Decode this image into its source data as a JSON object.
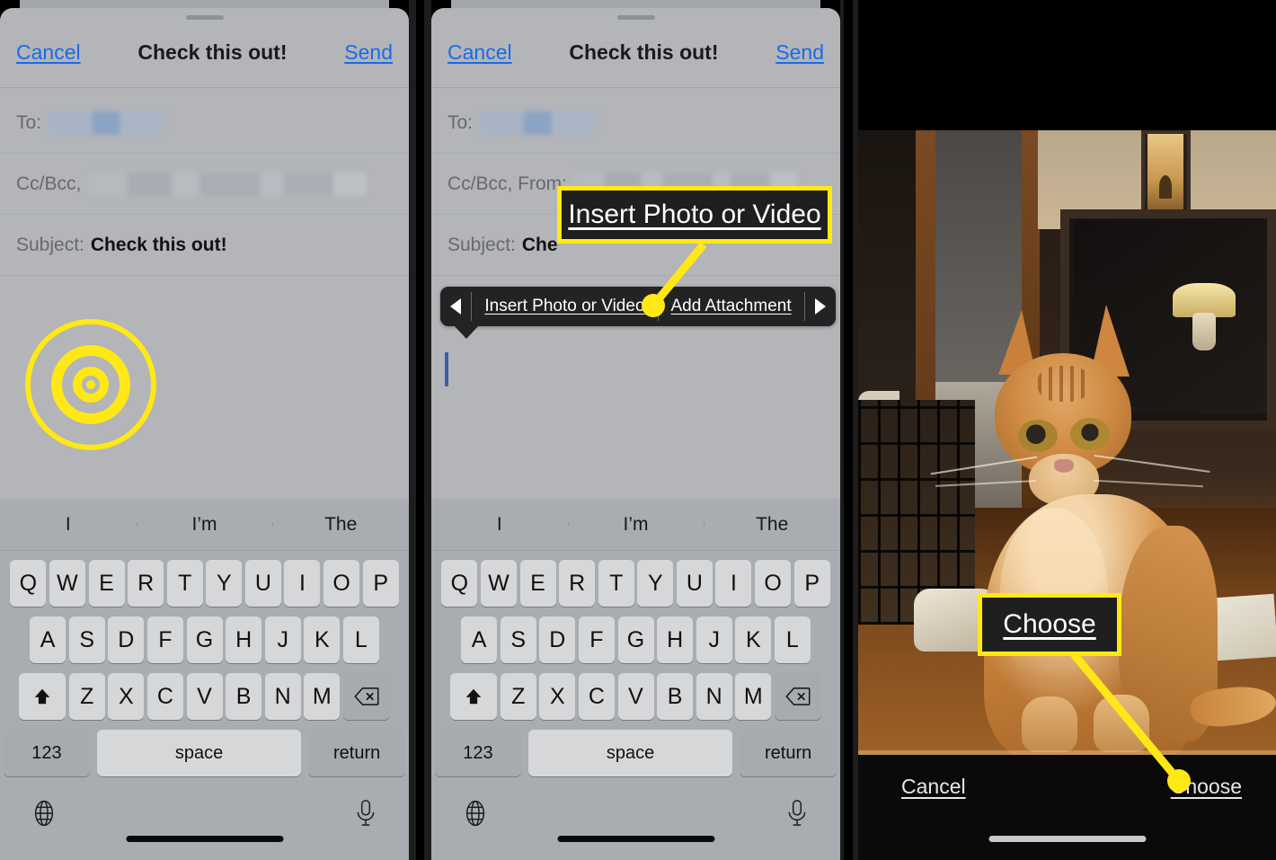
{
  "annotation": {
    "accent_color": "#ffe815",
    "callout_bg": "#1f1f1f",
    "callout_1_text": "Insert Photo or Video",
    "callout_2_text": "Choose"
  },
  "panel1": {
    "nav": {
      "cancel": "Cancel",
      "title": "Check this out!",
      "send": "Send"
    },
    "fields": {
      "to_label": "To:",
      "cc_label": "Cc/Bcc,",
      "subject_label": "Subject:",
      "subject_value": "Check this out!"
    },
    "keyboard": {
      "predictions": [
        "I",
        "I’m",
        "The"
      ],
      "row1": [
        "Q",
        "W",
        "E",
        "R",
        "T",
        "Y",
        "U",
        "I",
        "O",
        "P"
      ],
      "row2": [
        "A",
        "S",
        "D",
        "F",
        "G",
        "H",
        "J",
        "K",
        "L"
      ],
      "row3": [
        "Z",
        "X",
        "C",
        "V",
        "B",
        "N",
        "M"
      ],
      "shift": "shift-icon",
      "backspace": "backspace-icon",
      "numbers": "123",
      "space": "space",
      "return": "return",
      "globe": "globe-icon",
      "mic": "microphone-icon"
    }
  },
  "panel2": {
    "nav": {
      "cancel": "Cancel",
      "title": "Check this out!",
      "send": "Send"
    },
    "fields": {
      "to_label": "To:",
      "cc_label": "Cc/Bcc, From:",
      "subject_label": "Subject:",
      "subject_value": "Che"
    },
    "context_menu": {
      "prev": "prev-arrow-icon",
      "items": [
        "Insert Photo or Video",
        "Add Attachment"
      ],
      "next": "next-arrow-icon"
    },
    "keyboard": {
      "predictions": [
        "I",
        "I’m",
        "The"
      ],
      "row1": [
        "Q",
        "W",
        "E",
        "R",
        "T",
        "Y",
        "U",
        "I",
        "O",
        "P"
      ],
      "row2": [
        "A",
        "S",
        "D",
        "F",
        "G",
        "H",
        "J",
        "K",
        "L"
      ],
      "row3": [
        "Z",
        "X",
        "C",
        "V",
        "B",
        "N",
        "M"
      ],
      "shift": "shift-icon",
      "backspace": "backspace-icon",
      "numbers": "123",
      "space": "space",
      "return": "return",
      "globe": "globe-icon",
      "mic": "microphone-icon"
    }
  },
  "panel3": {
    "photo_description": "orange tabby cat sitting on wooden table in living room",
    "toolbar": {
      "cancel": "Cancel",
      "choose": "Choose"
    }
  }
}
